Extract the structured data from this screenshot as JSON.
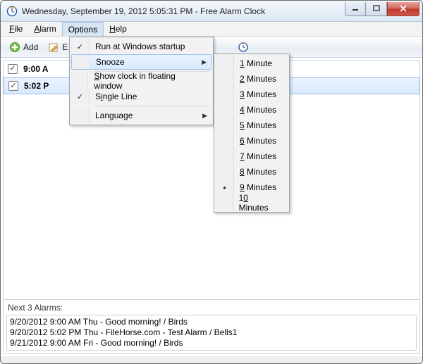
{
  "title": "Wednesday, September 19, 2012 5:05:31 PM - Free Alarm Clock",
  "menubar": {
    "file": "File",
    "alarm": "Alarm",
    "options": "Options",
    "help": "Help"
  },
  "toolbar": {
    "add": "Add",
    "edit_fragment": "E"
  },
  "options_menu": {
    "run_startup": "Run at Windows startup",
    "snooze": "Snooze",
    "show_clock": "Show clock in floating window",
    "single_line": "Single Line",
    "language": "Language"
  },
  "snooze_submenu": {
    "items": [
      {
        "label": "1 Minute",
        "ul": "1"
      },
      {
        "label": "2 Minutes",
        "ul": "2"
      },
      {
        "label": "3 Minutes",
        "ul": "3"
      },
      {
        "label": "4 Minutes",
        "ul": "4"
      },
      {
        "label": "5 Minutes",
        "ul": "5"
      },
      {
        "label": "6 Minutes",
        "ul": "6"
      },
      {
        "label": "7 Minutes",
        "ul": "7"
      },
      {
        "label": "8 Minutes",
        "ul": "8"
      },
      {
        "label": "9 Minutes",
        "ul": "9",
        "selected": true
      },
      {
        "label": "10 Minutes",
        "ul": "0"
      }
    ]
  },
  "alarms": [
    {
      "time": "9:00 A",
      "checked": true
    },
    {
      "time": "5:02 P",
      "checked": true,
      "selected": true
    }
  ],
  "next_alarms": {
    "label": "Next 3 Alarms:",
    "lines": [
      "9/20/2012 9:00 AM Thu - Good morning! / Birds",
      "9/20/2012 5:02 PM Thu - FileHorse.com - Test Alarm / Bells1",
      "9/21/2012 9:00 AM Fri - Good morning! / Birds"
    ]
  }
}
